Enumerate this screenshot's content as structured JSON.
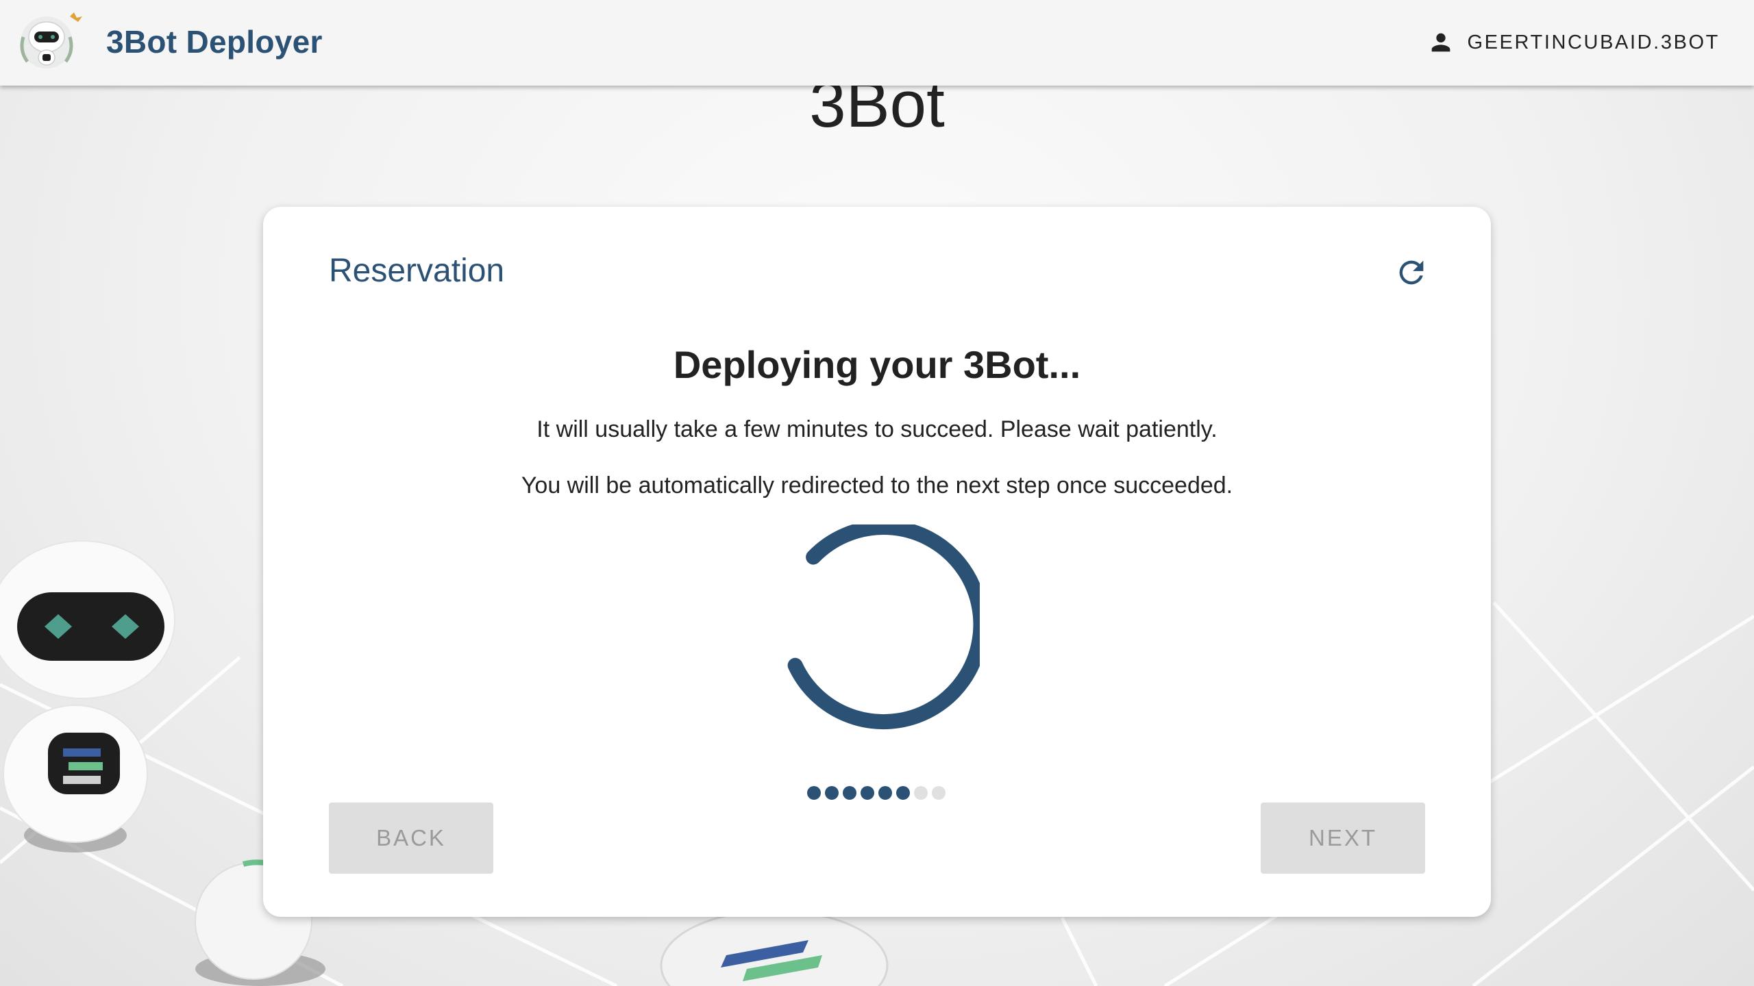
{
  "header": {
    "app_title": "3Bot Deployer",
    "user_name": "GEERTINCUBAID.3BOT",
    "logo_icon": "robot-logo-icon",
    "user_icon": "person-icon"
  },
  "page": {
    "heading": "3Bot"
  },
  "card": {
    "title": "Reservation",
    "refresh_icon": "refresh-icon",
    "status_heading": "Deploying your 3Bot...",
    "message_1": "It will usually take a few minutes to succeed. Please wait patiently.",
    "message_2": "You will be automatically redirected to the next step once succeeded.",
    "stepper": {
      "total_steps": 8,
      "completed_steps": 6
    },
    "back_label": "BACK",
    "next_label": "NEXT"
  },
  "colors": {
    "brand": "#2b5174",
    "button_disabled_bg": "#dedede",
    "button_disabled_text": "#9a9a9a"
  }
}
